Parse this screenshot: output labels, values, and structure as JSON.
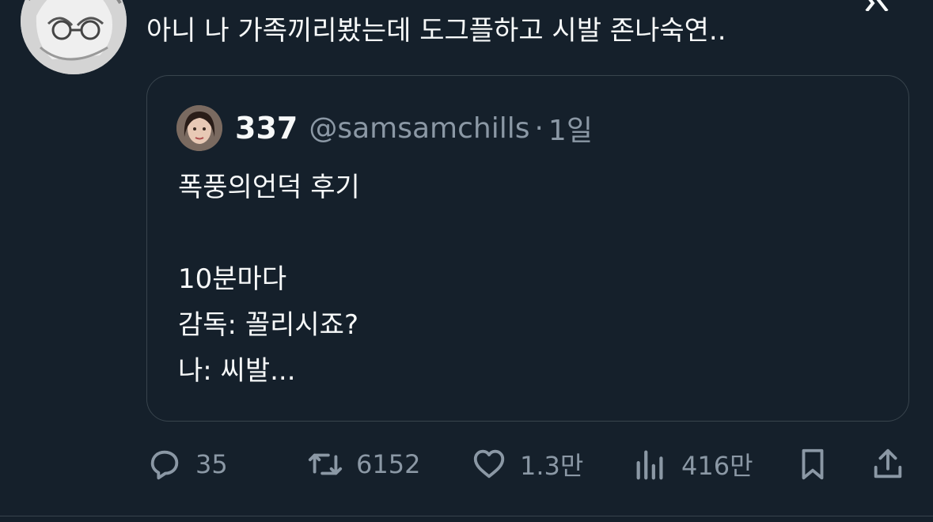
{
  "tweet": {
    "text": "아니 나 가족끼리봤는데 도그플하고 시발 존나숙연.."
  },
  "quote": {
    "name": "337",
    "handle": "@samsamchills",
    "separator": "·",
    "time": "1일",
    "lines": [
      "폭풍의언덕 후기",
      "",
      "10분마다",
      "감독: 꼴리시죠?",
      "나: 씨발..."
    ]
  },
  "actions": {
    "reply_count": "35",
    "retweet_count": "6152",
    "like_count": "1.3만",
    "view_count": "416만"
  },
  "icons": {
    "reply": "reply-icon",
    "retweet": "retweet-icon",
    "like": "like-icon",
    "views": "views-icon",
    "bookmark": "bookmark-icon",
    "share": "share-icon"
  },
  "colors": {
    "background": "#15202b",
    "text": "#f7f9f9",
    "secondary": "#8b98a5",
    "border": "#38444d"
  }
}
